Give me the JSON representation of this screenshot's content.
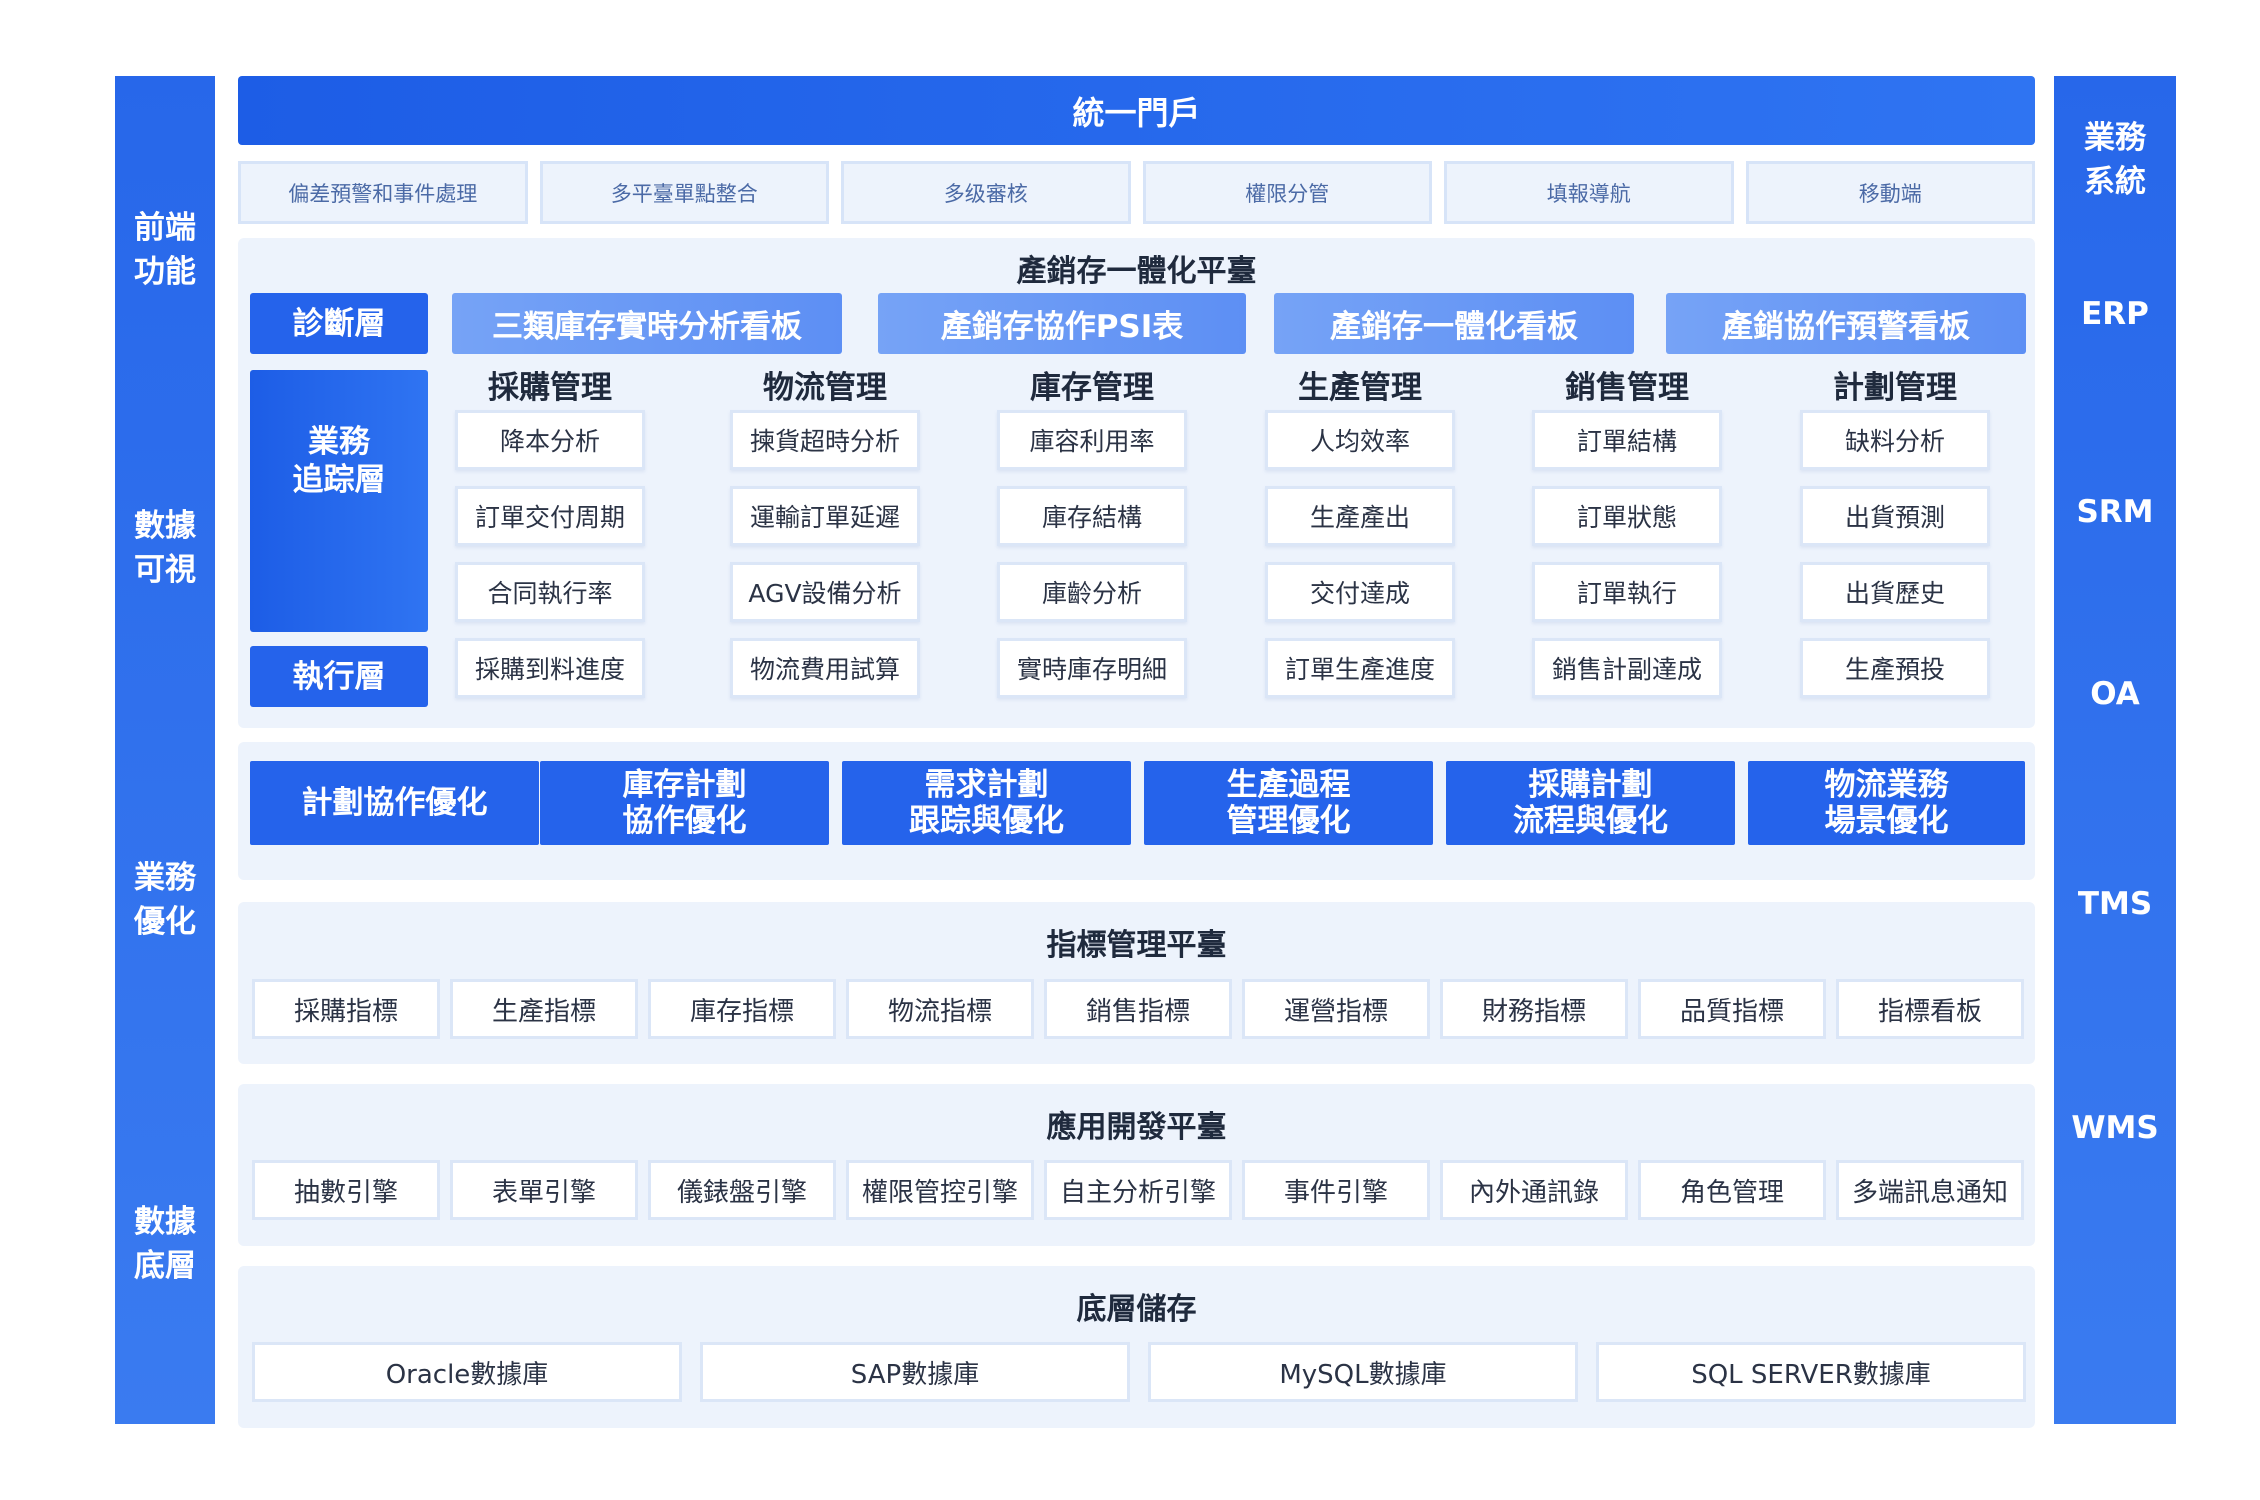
{
  "left_labels": [
    "前端\n功能",
    "數據\n可視",
    "業務\n優化",
    "數據\n底層"
  ],
  "right_labels": [
    "業務\n系統",
    "ERP",
    "SRM",
    "OA",
    "TMS",
    "WMS"
  ],
  "portal": {
    "title": "統一門戶"
  },
  "features": [
    "偏差預警和事件處理",
    "多平臺單點整合",
    "多级審核",
    "權限分管",
    "填報導航",
    "移動端"
  ],
  "psi": {
    "title": "產銷存一體化平臺",
    "diagnosis_label": "診斷層",
    "tracking_label": "業務\n追踪層",
    "execution_label": "執行層",
    "boards": [
      "三類庫存實時分析看板",
      "產銷存協作PSI表",
      "產銷存一體化看板",
      "產銷協作預警看板"
    ],
    "columns": [
      {
        "title": "採購管理",
        "items": [
          "降本分析",
          "訂單交付周期",
          "合同執行率",
          "採購到料進度"
        ]
      },
      {
        "title": "物流管理",
        "items": [
          "揀貨超時分析",
          "運輸訂單延遲",
          "AGV設備分析",
          "物流費用試算"
        ]
      },
      {
        "title": "庫存管理",
        "items": [
          "庫容利用率",
          "庫存結構",
          "庫齡分析",
          "實時庫存明細"
        ]
      },
      {
        "title": "生產管理",
        "items": [
          "人均效率",
          "生產產出",
          "交付達成",
          "訂單生產進度"
        ]
      },
      {
        "title": "銷售管理",
        "items": [
          "訂單結構",
          "訂單狀態",
          "訂單執行",
          "銷售計副達成"
        ]
      },
      {
        "title": "計劃管理",
        "items": [
          "缺料分析",
          "出貨預測",
          "出貨歷史",
          "生產預投"
        ]
      }
    ]
  },
  "optimization": [
    "計劃協作優化",
    "庫存計劃\n協作優化",
    "需求計劃\n跟踪與優化",
    "生產過程\n管理優化",
    "採購計劃\n流程與優化",
    "物流業務\n場景優化"
  ],
  "indicator": {
    "title": "指標管理平臺",
    "items": [
      "採購指標",
      "生產指標",
      "庫存指標",
      "物流指標",
      "銷售指標",
      "運營指標",
      "財務指標",
      "品質指標",
      "指標看板"
    ]
  },
  "appdev": {
    "title": "應用開發平臺",
    "items": [
      "抽數引擎",
      "表單引擎",
      "儀錶盤引擎",
      "權限管控引擎",
      "自主分析引擎",
      "事件引擎",
      "內外通訊錄",
      "角色管理",
      "多端訊息通知"
    ]
  },
  "storage": {
    "title": "底層儲存",
    "items": [
      "Oracle數據庫",
      "SAP數據庫",
      "MySQL數據庫",
      "SQL SERVER數據庫"
    ]
  }
}
